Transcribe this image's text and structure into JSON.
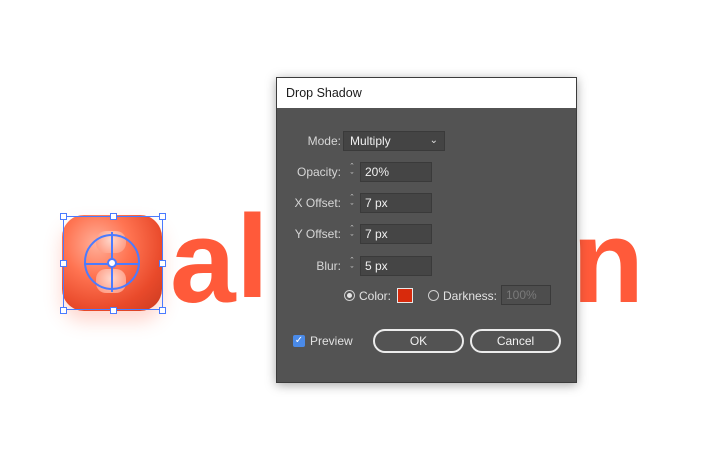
{
  "artwork": {
    "word_letters": [
      "a",
      "l",
      "n"
    ]
  },
  "dialog": {
    "title": "Drop Shadow",
    "mode": {
      "label": "Mode:",
      "value": "Multiply"
    },
    "opacity": {
      "label": "Opacity:",
      "value": "20%"
    },
    "x_offset": {
      "label": "X Offset:",
      "value": "7 px"
    },
    "y_offset": {
      "label": "Y Offset:",
      "value": "7 px"
    },
    "blur": {
      "label": "Blur:",
      "value": "5 px"
    },
    "color_option": {
      "label": "Color:",
      "selected": true,
      "swatch": "#d82a0c"
    },
    "darkness_option": {
      "label": "Darkness:",
      "value": "100%",
      "selected": false
    },
    "preview": {
      "label": "Preview",
      "checked": true
    },
    "ok_label": "OK",
    "cancel_label": "Cancel"
  },
  "colors": {
    "dialog_bg": "#535353",
    "accent": "#ff5a3a",
    "selection": "#4a7bff"
  }
}
